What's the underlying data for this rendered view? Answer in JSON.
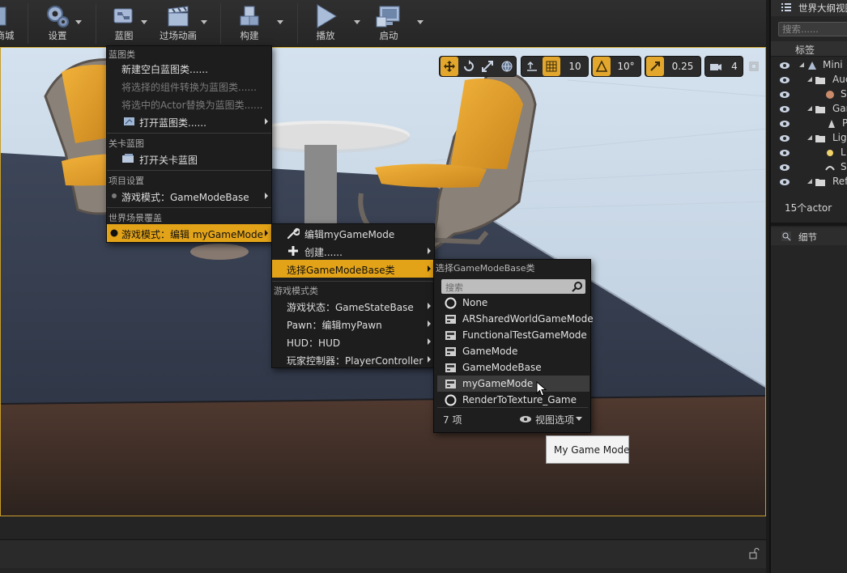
{
  "toolbar": {
    "items": [
      {
        "label": "商城",
        "icon": "marketplace-icon"
      },
      {
        "label": "设置",
        "icon": "settings-gears-icon"
      },
      {
        "label": "蓝图",
        "icon": "blueprint-icon"
      },
      {
        "label": "过场动画",
        "icon": "cinematics-clapper-icon"
      },
      {
        "label": "构建",
        "icon": "build-blocks-icon"
      },
      {
        "label": "播放",
        "icon": "play-icon"
      },
      {
        "label": "启动",
        "icon": "launch-monitor-icon"
      }
    ]
  },
  "viewport_tools": {
    "grid_snap": "10",
    "rotate_snap": "10°",
    "scale_snap": "0.25",
    "camera_speed": "4"
  },
  "blueprint_menu": {
    "sec_blueprint_class": "蓝图类",
    "new_empty": "新建空白蓝图类......",
    "convert_components": "将选择的组件转换为蓝图类......",
    "replace_actor": "将选中的Actor替换为蓝图类......",
    "open_class": "打开蓝图类......",
    "sec_level_blueprint": "关卡蓝图",
    "open_level": "打开关卡蓝图",
    "sec_project_settings": "项目设置",
    "project_gamemode": "游戏模式：GameModeBase",
    "sec_world_override": "世界场景覆盖",
    "world_gamemode": "游戏模式：编辑 myGameMode"
  },
  "gamemode_menu": {
    "edit": "编辑myGameMode",
    "create": "创建......",
    "select_class": "选择GameModeBase类",
    "sec_classes": "游戏模式类",
    "game_state": "游戏状态：GameStateBase",
    "pawn": "Pawn：编辑myPawn",
    "hud": "HUD：HUD",
    "player_controller": "玩家控制器：PlayerController"
  },
  "class_picker": {
    "title": "选择GameModeBase类",
    "search_placeholder": "搜索",
    "items": [
      {
        "label": "None",
        "icon": "none-circle-icon"
      },
      {
        "label": "ARSharedWorldGameMode",
        "icon": "class-icon"
      },
      {
        "label": "FunctionalTestGameMode",
        "icon": "class-icon"
      },
      {
        "label": "GameMode",
        "icon": "class-icon"
      },
      {
        "label": "GameModeBase",
        "icon": "class-icon"
      },
      {
        "label": "myGameMode",
        "icon": "class-icon"
      },
      {
        "label": "RenderToTexture_Game",
        "icon": "none-circle-icon"
      }
    ],
    "count": "7 项",
    "view_options": "视图选项"
  },
  "tooltip": "My Game Mode",
  "outliner": {
    "title": "世界大纲视图",
    "search_placeholder": "搜索......",
    "column": "标签",
    "rows": [
      {
        "label": "Mini",
        "indent": 0
      },
      {
        "label": "Auc",
        "indent": 1
      },
      {
        "label": "S",
        "indent": 2
      },
      {
        "label": "Gar",
        "indent": 1
      },
      {
        "label": "P",
        "indent": 2
      },
      {
        "label": "Lig",
        "indent": 1
      },
      {
        "label": "L",
        "indent": 2
      },
      {
        "label": "S",
        "indent": 2
      },
      {
        "label": "Ref",
        "indent": 1
      }
    ],
    "count": "15个actor",
    "details_tab": "细节"
  }
}
